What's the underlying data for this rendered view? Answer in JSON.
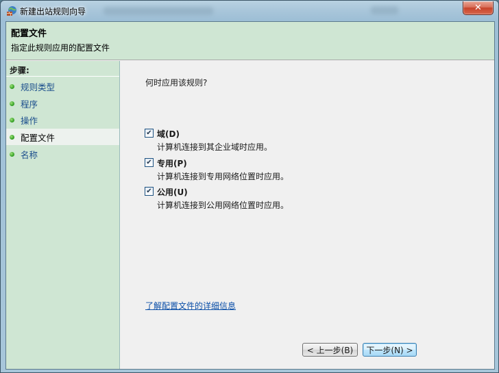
{
  "window": {
    "title": "新建出站规则向导",
    "close_label": "✕"
  },
  "header": {
    "title": "配置文件",
    "subtitle": "指定此规则应用的配置文件"
  },
  "sidebar": {
    "steps_label": "步骤:",
    "items": [
      {
        "label": "规则类型",
        "current": false
      },
      {
        "label": "程序",
        "current": false
      },
      {
        "label": "操作",
        "current": false
      },
      {
        "label": "配置文件",
        "current": true
      },
      {
        "label": "名称",
        "current": false
      }
    ]
  },
  "content": {
    "question": "何时应用该规则?",
    "options": [
      {
        "name": "域(D)",
        "description": "计算机连接到其企业域时应用。",
        "checked": true
      },
      {
        "name": "专用(P)",
        "description": "计算机连接到专用网络位置时应用。",
        "checked": true
      },
      {
        "name": "公用(U)",
        "description": "计算机连接到公用网络位置时应用。",
        "checked": true
      }
    ],
    "learn_more_link": "了解配置文件的详细信息"
  },
  "buttons": {
    "back_label": "< 上一步(B)",
    "next_label": "下一步(N) >"
  },
  "colors": {
    "panel_green": "#cfe6d3",
    "link_blue": "#0b4fa8",
    "step_dot_green": "#3aa52a"
  }
}
